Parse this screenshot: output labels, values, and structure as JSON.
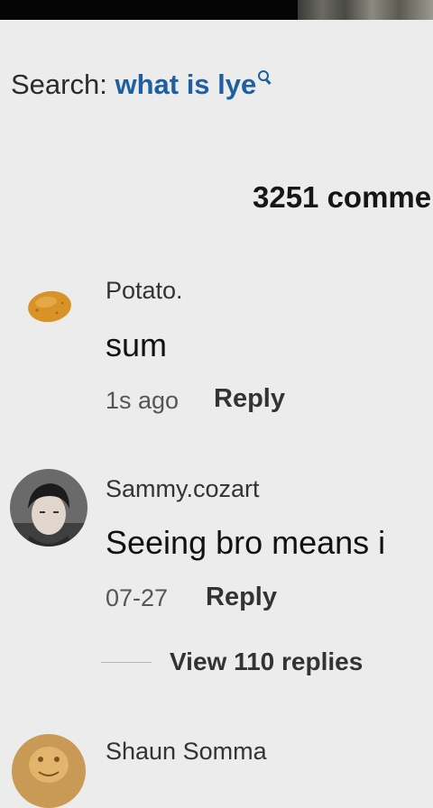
{
  "search": {
    "prefix": "Search:",
    "query": "what is lye",
    "icon": "search-icon"
  },
  "comments_header": {
    "count_label": "3251 comme"
  },
  "comments": [
    {
      "author": "Potato.",
      "text": "sum",
      "time": "1s ago",
      "reply_label": "Reply",
      "avatar": "potato-avatar"
    },
    {
      "author": "Sammy.cozart",
      "text": "Seeing bro means i",
      "time": "07-27",
      "reply_label": "Reply",
      "avatar": "user-photo-avatar",
      "view_replies_label": "View 110 replies"
    },
    {
      "author": "Shaun Somma",
      "avatar": "user-photo-avatar"
    }
  ],
  "colors": {
    "background": "#ececec",
    "search_query": "#1f5fa0",
    "top_bar": "#050505"
  }
}
